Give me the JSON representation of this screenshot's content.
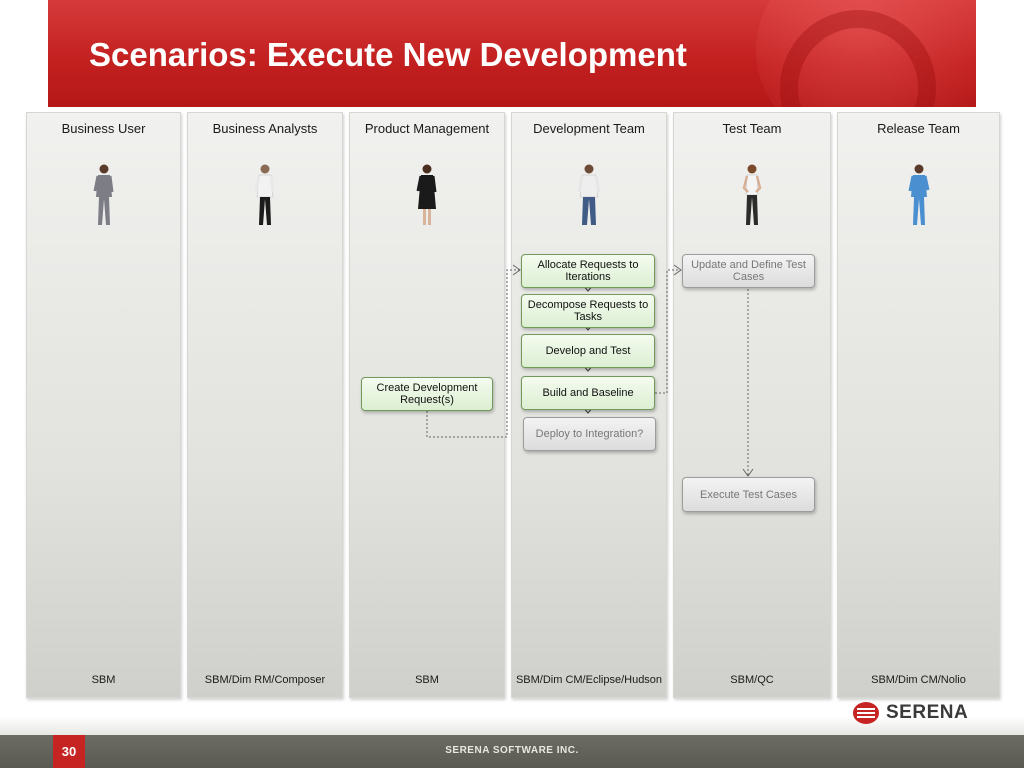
{
  "slide": {
    "title": "Scenarios: Execute New Development",
    "page_number": "30",
    "company": "SERENA SOFTWARE INC.",
    "logo_text": "SERENA"
  },
  "lanes": [
    {
      "title": "Business User",
      "footer": "SBM"
    },
    {
      "title": "Business Analysts",
      "footer": "SBM/Dim RM/Composer"
    },
    {
      "title": "Product Management",
      "footer": "SBM"
    },
    {
      "title": "Development Team",
      "footer": "SBM/Dim CM/Eclipse/Hudson"
    },
    {
      "title": "Test Team",
      "footer": "SBM/QC"
    },
    {
      "title": "Release Team",
      "footer": "SBM/Dim CM/Nolio"
    }
  ],
  "boxes": {
    "create_request": "Create Development Request(s)",
    "allocate": "Allocate Requests to Iterations",
    "decompose": "Decompose Requests to Tasks",
    "develop_test": "Develop and Test",
    "build_baseline": "Build and Baseline",
    "deploy": "Deploy to Integration?",
    "update_tests": "Update and Define Test Cases",
    "execute_tests": "Execute Test Cases"
  },
  "colors": {
    "brand_red": "#c21f1f",
    "task_green_border": "#6f9a5a",
    "optional_grey_text": "#777777"
  }
}
